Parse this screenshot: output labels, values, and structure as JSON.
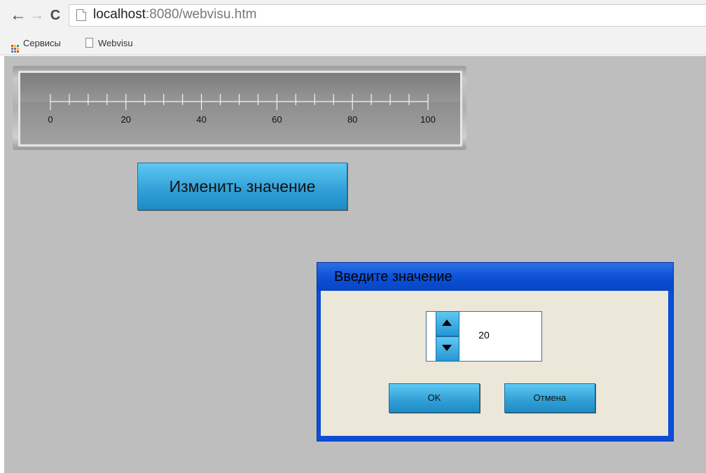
{
  "browser": {
    "nav": {
      "back_glyph": "←",
      "forward_glyph": "→",
      "reload_glyph": "C"
    },
    "url": {
      "host": "localhost",
      "rest": ":8080/webvisu.htm"
    },
    "bookmarks": [
      {
        "label": "Сервисы",
        "icon": "apps-grid-icon"
      },
      {
        "label": "Webvisu",
        "icon": "page-icon"
      }
    ]
  },
  "meter": {
    "scale_min": 0,
    "scale_max": 100,
    "labels": [
      "0",
      "20",
      "40",
      "60",
      "80",
      "100"
    ],
    "minor_step": 5
  },
  "change_button": {
    "label": "Изменить значение"
  },
  "dialog": {
    "title": "Введите значение",
    "value": "20",
    "ok_label": "OK",
    "cancel_label": "Отмена"
  },
  "colors": {
    "background": "#bebebe",
    "button_blue": "#2f9fd6",
    "dialog_border": "#0b4fd8",
    "dialog_body": "#ebe7d9"
  }
}
